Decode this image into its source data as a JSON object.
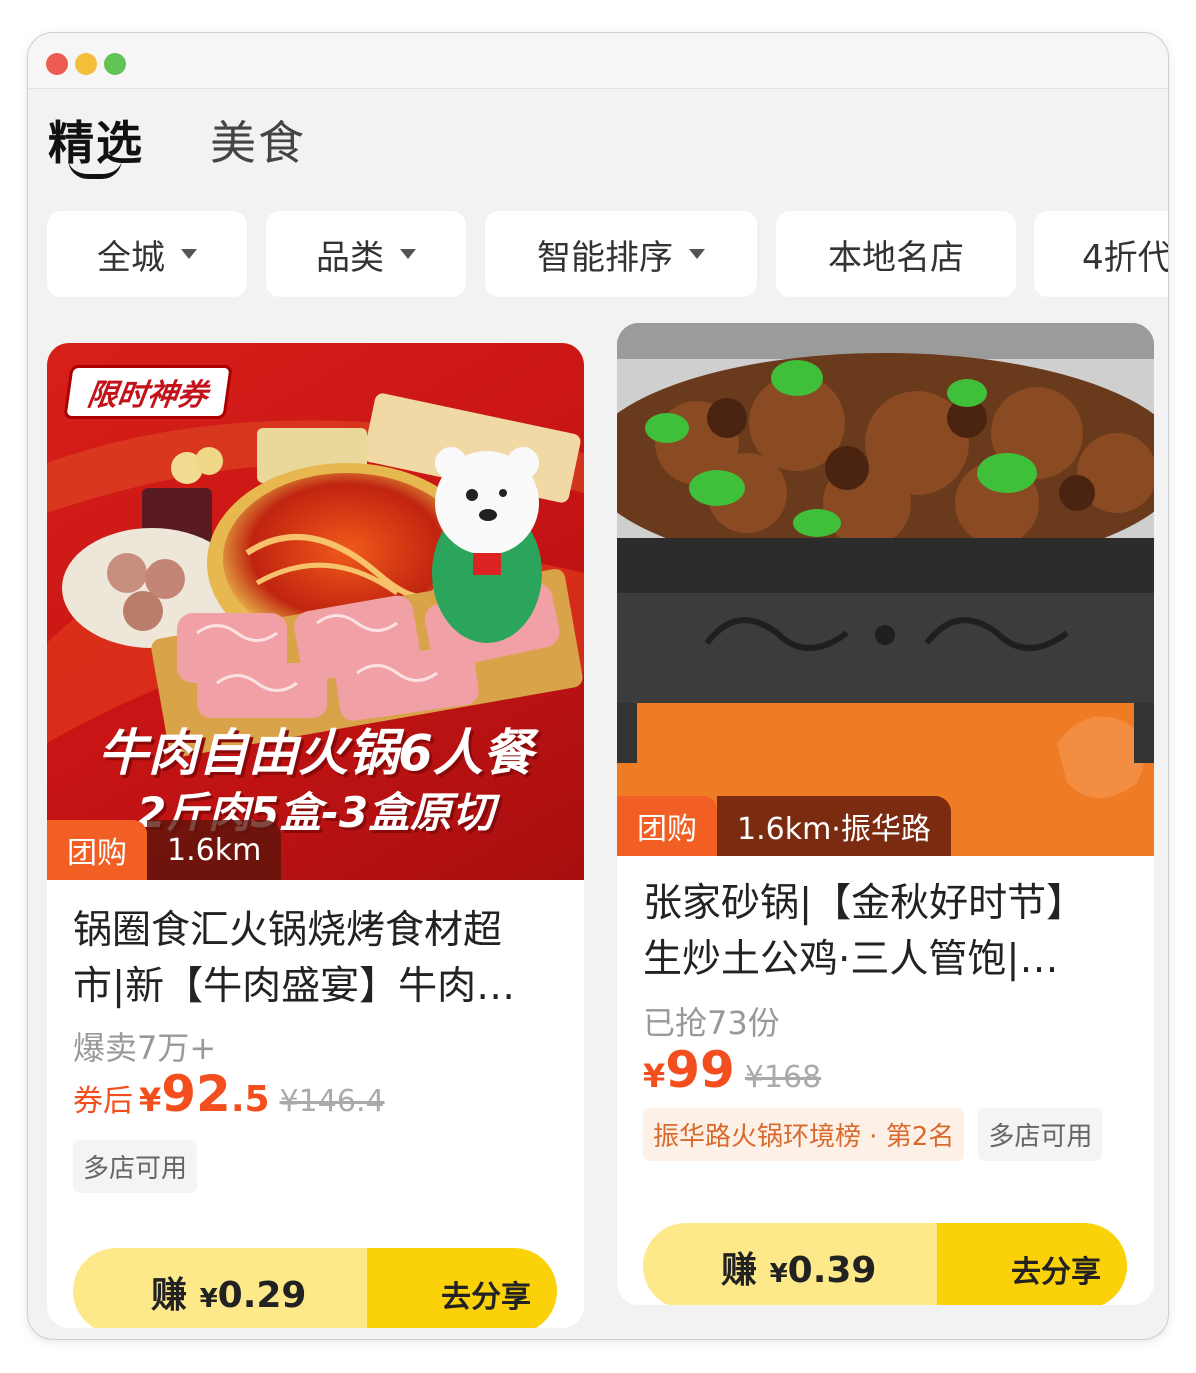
{
  "tabs": [
    {
      "label": "精选",
      "active": true
    },
    {
      "label": "美食",
      "active": false
    }
  ],
  "filters": [
    {
      "label": "全城",
      "dropdown": true
    },
    {
      "label": "品类",
      "dropdown": true
    },
    {
      "label": "智能排序",
      "dropdown": true
    },
    {
      "label": "本地名店",
      "dropdown": false
    },
    {
      "label": "4折代",
      "dropdown": false
    }
  ],
  "cards": [
    {
      "image_banner": "限时神券",
      "image_headline": "牛肉自由火锅6人餐",
      "image_subline": "2斤肉5盒-3盒原切",
      "badge": "团购",
      "distance": "1.6km",
      "title": "锅圈食汇火锅烧烤食材超市|新【牛肉盛宴】牛肉…",
      "sold": "爆卖7万+",
      "price_label": "券后",
      "currency": "¥",
      "price_int": "92",
      "price_dec": ".5",
      "original_price": "¥146.4",
      "tags": [
        "多店可用"
      ],
      "earn_currency": "¥",
      "earn_amount": "0.29",
      "earn_prefix": "赚",
      "share_label": "去分享"
    },
    {
      "badge": "团购",
      "distance": "1.6km·振华路",
      "title": "张家砂锅|【金秋好时节】生炒土公鸡·三人管饱|…",
      "sold": "已抢73份",
      "currency": "¥",
      "price_int": "99",
      "original_price": "¥168",
      "rank_tag": "振华路火锅环境榜 · 第2名",
      "tags": [
        "多店可用"
      ],
      "earn_currency": "¥",
      "earn_amount": "0.39",
      "earn_prefix": "赚",
      "share_label": "去分享"
    }
  ],
  "colors": {
    "accent_orange": "#f24e1e",
    "badge_orange": "#f25f24",
    "earn_light": "#fde98a",
    "earn_dark": "#fbd10a"
  }
}
